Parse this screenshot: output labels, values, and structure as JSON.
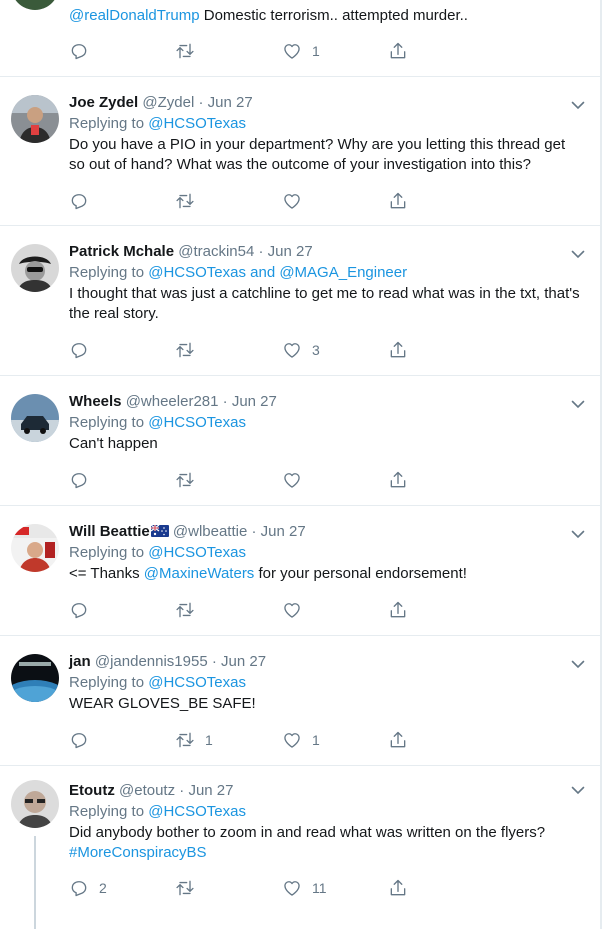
{
  "tweets": [
    {
      "id": "t0",
      "partial": true,
      "reply_to": "@realDonaldTrump",
      "text_after": "Domestic terrorism.. attempted murder..",
      "counts": {
        "reply": "",
        "retweet": "",
        "like": "1"
      }
    },
    {
      "id": "t1",
      "name": "Joe Zydel",
      "handle": "@Zydel",
      "date": "Jun 27",
      "replying_label": "Replying to",
      "reply_targets": "@HCSOTexas",
      "text": "Do you have a PIO in your department? Why are you letting this thread get so out of hand? What was the outcome of your investigation into this?",
      "counts": {
        "reply": "",
        "retweet": "",
        "like": ""
      }
    },
    {
      "id": "t2",
      "name": "Patrick Mchale",
      "handle": "@trackin54",
      "date": "Jun 27",
      "replying_label": "Replying to",
      "reply_targets": "@HCSOTexas and @MAGA_Engineer",
      "text": "I thought that was just a catchline to get me to read what was in the txt, that's the real story.",
      "counts": {
        "reply": "",
        "retweet": "",
        "like": "3"
      }
    },
    {
      "id": "t3",
      "name": "Wheels",
      "handle": "@wheeler281",
      "date": "Jun 27",
      "replying_label": "Replying to",
      "reply_targets": "@HCSOTexas",
      "text": "Can't happen",
      "counts": {
        "reply": "",
        "retweet": "",
        "like": ""
      }
    },
    {
      "id": "t4",
      "name": "Will Beattie",
      "handle": "@wlbeattie",
      "date": "Jun 27",
      "replying_label": "Replying to",
      "reply_targets": "@HCSOTexas",
      "text_before": "<= Thanks ",
      "text_link": "@MaxineWaters",
      "text_after": " for your personal endorsement!",
      "counts": {
        "reply": "",
        "retweet": "",
        "like": ""
      }
    },
    {
      "id": "t5",
      "name": "jan",
      "handle": "@jandennis1955",
      "date": "Jun 27",
      "replying_label": "Replying to",
      "reply_targets": "@HCSOTexas",
      "text": "WEAR GLOVES_BE SAFE!",
      "counts": {
        "reply": "",
        "retweet": "1",
        "like": "1"
      }
    },
    {
      "id": "t6",
      "name": "Etoutz",
      "handle": "@etoutz",
      "date": "Jun 27",
      "replying_label": "Replying to",
      "reply_targets": "@HCSOTexas",
      "text": "Did anybody bother to zoom in and read what was written on the flyers?",
      "hashtag": "#MoreConspiracyBS",
      "counts": {
        "reply": "2",
        "retweet": "",
        "like": "11"
      }
    }
  ],
  "separator_dot": "·",
  "icons": [
    "reply-icon",
    "retweet-icon",
    "like-icon",
    "share-icon",
    "chevron-down-icon"
  ],
  "colors": {
    "link": "#1b95e0",
    "muted": "#657786",
    "border": "#e6ecf0"
  }
}
